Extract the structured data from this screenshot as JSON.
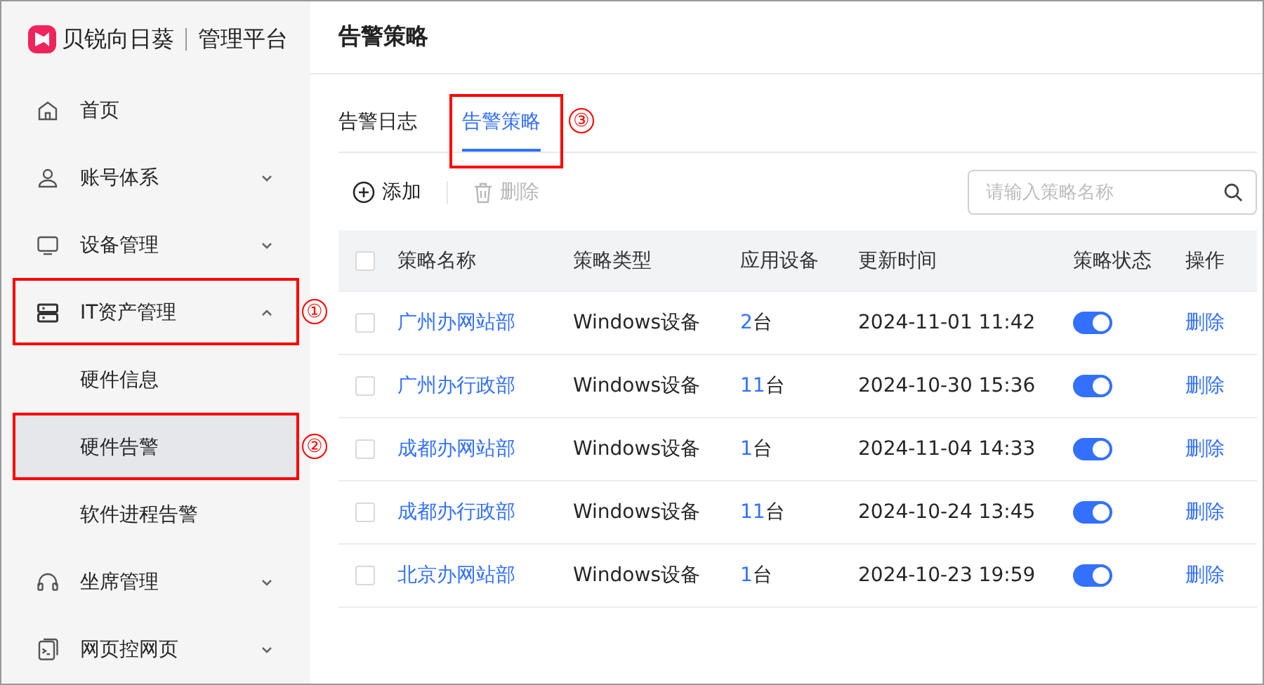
{
  "brand": {
    "name": "贝锐向日葵",
    "product": "管理平台"
  },
  "sidebar": {
    "items": [
      {
        "label": "首页",
        "kind": "home",
        "selected": false
      },
      {
        "label": "账号体系",
        "kind": "user",
        "expanded": false,
        "selected": false
      },
      {
        "label": "设备管理",
        "kind": "monitor",
        "expanded": false,
        "selected": false
      },
      {
        "label": "IT资产管理",
        "kind": "server",
        "expanded": true,
        "selected": false,
        "callout": "①",
        "children": [
          {
            "label": "硬件信息",
            "selected": false
          },
          {
            "label": "硬件告警",
            "selected": true,
            "callout": "②"
          },
          {
            "label": "软件进程告警",
            "selected": false
          }
        ]
      },
      {
        "label": "坐席管理",
        "kind": "headset",
        "expanded": false,
        "selected": false
      },
      {
        "label": "网页控网页",
        "kind": "terminal",
        "expanded": false,
        "selected": false
      }
    ]
  },
  "page_title": "告警策略",
  "tabs": [
    {
      "label": "告警日志",
      "selected": false
    },
    {
      "label": "告警策略",
      "selected": true,
      "callout": "③"
    }
  ],
  "toolbar": {
    "add": {
      "label": "添加",
      "disabled": false
    },
    "delete": {
      "label": "删除",
      "disabled": true
    },
    "search": {
      "placeholder": "请输入策略名称"
    }
  },
  "table": {
    "columns": [
      "策略名称",
      "策略类型",
      "应用设备",
      "更新时间",
      "策略状态",
      "操作"
    ],
    "header_checked": false,
    "rows": [
      {
        "checked": false,
        "name": "广州办网站部",
        "type": "Windows设备",
        "count": "2",
        "unit": "台",
        "updated": "2024-11-01 11:42",
        "on": true,
        "action": "删除"
      },
      {
        "checked": false,
        "name": "广州办行政部",
        "type": "Windows设备",
        "count": "11",
        "unit": "台",
        "updated": "2024-10-30 15:36",
        "on": true,
        "action": "删除"
      },
      {
        "checked": false,
        "name": "成都办网站部",
        "type": "Windows设备",
        "count": "1",
        "unit": "台",
        "updated": "2024-11-04 14:33",
        "on": true,
        "action": "删除"
      },
      {
        "checked": false,
        "name": "成都办行政部",
        "type": "Windows设备",
        "count": "11",
        "unit": "台",
        "updated": "2024-10-24 13:45",
        "on": true,
        "action": "删除"
      },
      {
        "checked": false,
        "name": "北京办网站部",
        "type": "Windows设备",
        "count": "1",
        "unit": "台",
        "updated": "2024-10-23 19:59",
        "on": true,
        "action": "删除"
      }
    ]
  }
}
